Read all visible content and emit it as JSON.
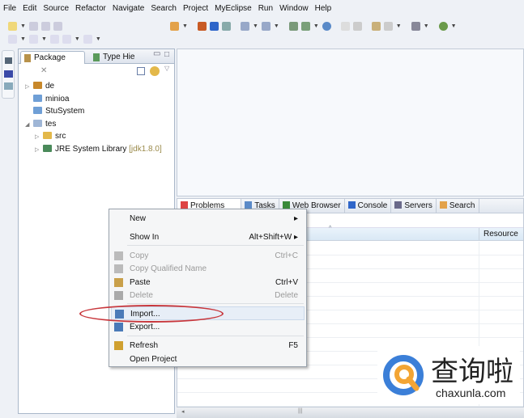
{
  "menubar": [
    "File",
    "Edit",
    "Source",
    "Refactor",
    "Navigate",
    "Search",
    "Project",
    "MyEclipse",
    "Run",
    "Window",
    "Help"
  ],
  "package_explorer": {
    "tabs": [
      "Package",
      "Type Hie"
    ],
    "tree": [
      {
        "label": "de",
        "indent": 0,
        "expander": "▷"
      },
      {
        "label": "minioa",
        "indent": 0,
        "expander": ""
      },
      {
        "label": "StuSystem",
        "indent": 0,
        "expander": ""
      },
      {
        "label": "tes",
        "indent": 0,
        "expander": "◢"
      },
      {
        "label": "src",
        "indent": 1,
        "expander": "▷"
      },
      {
        "label": "JRE System Library",
        "suffix": "[jdk1.8.0]",
        "indent": 1,
        "expander": "▷"
      }
    ]
  },
  "bottom_panel": {
    "tabs": [
      "Problems",
      "Tasks",
      "Web Browser",
      "Console",
      "Servers",
      "Search"
    ],
    "columns": [
      "",
      "Resource"
    ]
  },
  "context_menu": [
    {
      "label": "New",
      "shortcut": "▸",
      "disabled": false
    },
    {
      "label": "Show In",
      "shortcut": "Alt+Shift+W ▸",
      "disabled": false
    },
    {
      "label": "Copy",
      "shortcut": "Ctrl+C",
      "disabled": true
    },
    {
      "label": "Copy Qualified Name",
      "shortcut": "",
      "disabled": true
    },
    {
      "label": "Paste",
      "shortcut": "Ctrl+V",
      "disabled": false
    },
    {
      "label": "Delete",
      "shortcut": "Delete",
      "disabled": true
    },
    {
      "label": "Import...",
      "shortcut": "",
      "disabled": false
    },
    {
      "label": "Export...",
      "shortcut": "",
      "disabled": false
    },
    {
      "label": "Refresh",
      "shortcut": "F5",
      "disabled": false
    },
    {
      "label": "Open Project",
      "shortcut": "",
      "disabled": false
    }
  ],
  "watermark": {
    "brand": "查询啦",
    "url": "chaxunla.com"
  },
  "colors": {
    "highlight_oval": "#c8373c",
    "accent": "#3b7fd8"
  }
}
